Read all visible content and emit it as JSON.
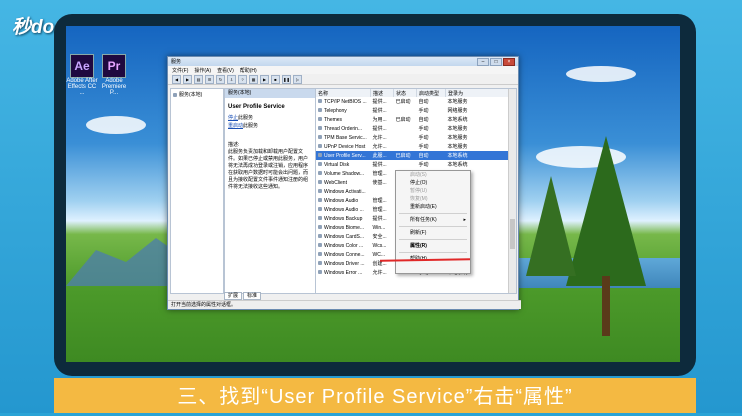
{
  "brand": {
    "logo_text": "秒dong视频"
  },
  "desktop_icons": [
    {
      "glyph": "Ae",
      "label": "Adobe After Effects CC ..."
    },
    {
      "glyph": "Pr",
      "label": "Adobe Premiere P..."
    }
  ],
  "window": {
    "title": "服务",
    "menu": [
      "文件(F)",
      "操作(A)",
      "查看(V)",
      "帮助(H)"
    ],
    "left_tree_item": "服务(本地)",
    "mid_header": "服务(本地)",
    "service_name": "User Profile Service",
    "stop_link": "停止",
    "stop_suffix": "此服务",
    "restart_link": "重启动",
    "restart_suffix": "此服务",
    "desc_title": "描述:",
    "description": "此服务负责加载和卸载用户配置文件。如果已停止或禁用此服务，用户将无法再成功登录或注销，应用程序在获取用户数据时可能会出问题，而且为接收配置文件事件通知注册的组件将无法接收这些通知。",
    "columns": [
      "名称",
      "描述",
      "状态",
      "启动类型",
      "登录为"
    ],
    "rows": [
      [
        "TCP/IP NetBIOS ...",
        "提供...",
        "已启动",
        "自动",
        "本地服务"
      ],
      [
        "Telephony",
        "提供...",
        "",
        "手动",
        "网络服务"
      ],
      [
        "Themes",
        "为用...",
        "已启动",
        "自动",
        "本地系统"
      ],
      [
        "Thread Orderin...",
        "提供...",
        "",
        "手动",
        "本地服务"
      ],
      [
        "TPM Base Servic...",
        "允许...",
        "",
        "手动",
        "本地服务"
      ],
      [
        "UPnP Device Host",
        "允许...",
        "",
        "手动",
        "本地服务"
      ],
      [
        "User Profile Serv...",
        "此服...",
        "已启动",
        "自动",
        "本地系统"
      ],
      [
        "Virtual Disk",
        "提供...",
        "",
        "手动",
        "本地系统"
      ],
      [
        "Volume Shadow...",
        "管理...",
        "",
        "手动",
        "本地系统"
      ],
      [
        "WebClient",
        "使基...",
        "",
        "手动",
        "本地服务"
      ],
      [
        "Windows Activati...",
        "",
        "",
        "手动",
        "本地系统"
      ],
      [
        "Windows Audio",
        "管理...",
        "",
        "手动",
        "本地服务"
      ],
      [
        "Windows Audio ...",
        "管理...",
        "",
        "手动",
        "本地系统"
      ],
      [
        "Windows Backup",
        "提供...",
        "",
        "手动",
        "本地系统"
      ],
      [
        "Windows Biome...",
        "Win...",
        "",
        "手动",
        "本地系统"
      ],
      [
        "Windows CardS...",
        "安全...",
        "",
        "手动",
        "本地系统"
      ],
      [
        "Windows Color ...",
        "Wcs...",
        "",
        "手动",
        "本地服务"
      ],
      [
        "Windows Conne...",
        "WC...",
        "",
        "手动",
        "本地服务"
      ],
      [
        "Windows Driver ...",
        "创建...",
        "",
        "手动",
        "本地系统"
      ],
      [
        "Windows Error ...",
        "允许...",
        "",
        "手动",
        "本地系统"
      ]
    ],
    "selected_row": 6,
    "tabs": [
      "扩展",
      "标准"
    ],
    "status_text": "打开当前选择的属性对话框。"
  },
  "context_menu": {
    "items": [
      {
        "label": "启动(S)",
        "disabled": true
      },
      {
        "label": "停止(O)",
        "disabled": false
      },
      {
        "label": "暂停(U)",
        "disabled": true
      },
      {
        "label": "恢复(M)",
        "disabled": true
      },
      {
        "label": "重新启动(E)",
        "disabled": false
      },
      {
        "label": "所有任务(K)",
        "disabled": false
      },
      {
        "label": "刷新(F)",
        "disabled": false
      },
      {
        "label": "属性(R)",
        "disabled": false
      },
      {
        "label": "帮助(H)",
        "disabled": false
      }
    ]
  },
  "caption": "三、找到“User Profile Service”右击“属性”",
  "colors": {
    "caption_bg": "#f4b942",
    "frame_bg": "#0d2a3c",
    "selection": "#3375d6",
    "underline": "#e02828"
  }
}
